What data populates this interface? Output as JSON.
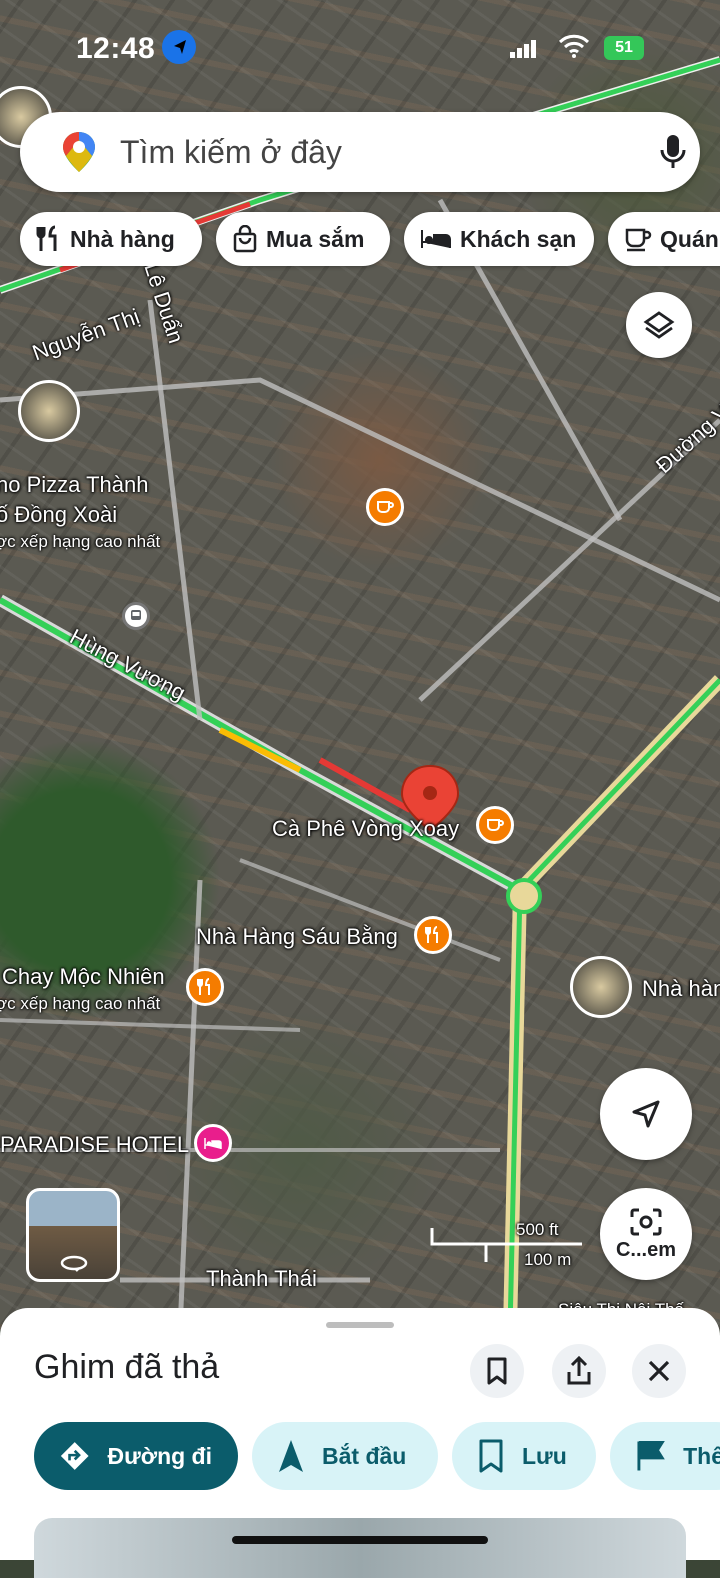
{
  "status": {
    "time": "12:48",
    "battery": "51"
  },
  "search": {
    "placeholder": "Tìm kiếm ở đây"
  },
  "chips": [
    {
      "label": "Nhà hàng",
      "icon": "restaurant-icon"
    },
    {
      "label": "Mua sắm",
      "icon": "shopping-bag-icon"
    },
    {
      "label": "Khách sạn",
      "icon": "hotel-icon"
    },
    {
      "label": "Quán",
      "icon": "coffee-icon"
    }
  ],
  "map_labels": {
    "street_le_duan": "Lê Duẩn",
    "street_nguyen_thi": "Nguyễn Thị",
    "street_hung_vuong": "Hùng Vương",
    "street_duong_v": "Đường V",
    "street_thanh_thai": "Thành Thái",
    "poi_pizza_line1": "no Pizza Thành",
    "poi_pizza_line2": "ố Đồng Xoài",
    "poi_pizza_sub": "ợc xếp hạng cao nhất",
    "poi_cafe": "Cà Phê Vòng Xoay",
    "poi_sau_bang": "Nhà Hàng Sáu Bằng",
    "poi_moc_nhien": "Chay Mộc Nhiên",
    "poi_moc_nhien_sub": "ợc xếp hạng cao nhất",
    "poi_nha_hang_right": "Nhà hàn",
    "poi_paradise": "PARADISE HOTEL",
    "poi_sieu_thi": "Siêu Thị Nội Thấ",
    "scale_ft": "500 ft",
    "scale_m": "100 m"
  },
  "camera_button": {
    "label": "C...em"
  },
  "sheet": {
    "title": "Ghim đã thả",
    "actions": [
      {
        "label": "Đường đi",
        "icon": "directions-icon"
      },
      {
        "label": "Bắt đầu",
        "icon": "navigation-arrow-icon"
      },
      {
        "label": "Lưu",
        "icon": "bookmark-icon"
      },
      {
        "label": "Thê",
        "icon": "flag-icon"
      }
    ]
  },
  "colors": {
    "primary_action": "#0b5c6b",
    "secondary_action": "#d8f3f7",
    "pin_red": "#ea4335",
    "poi_orange": "#f57c00",
    "poi_pink": "#e91e8c",
    "traffic_green": "#34d058"
  }
}
